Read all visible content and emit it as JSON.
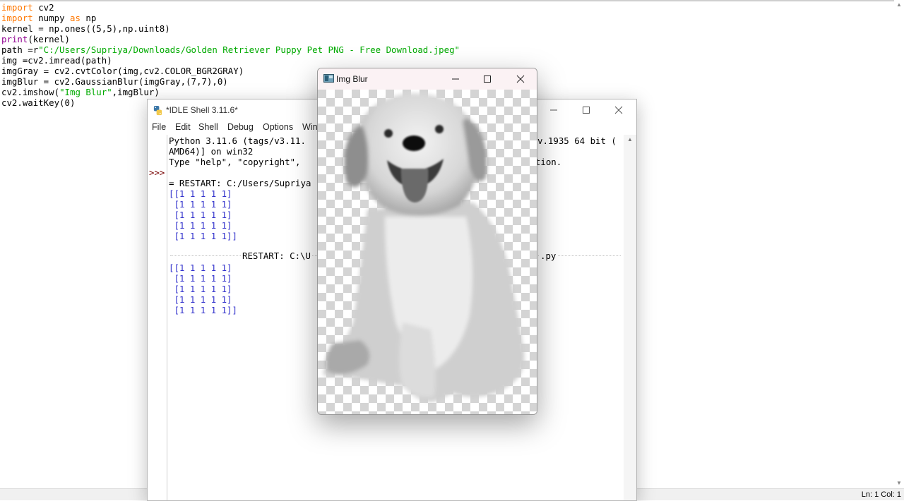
{
  "editor": {
    "code_lines": [
      [
        {
          "t": "import",
          "c": "kw"
        },
        {
          "t": " cv2"
        }
      ],
      [
        {
          "t": "import",
          "c": "kw"
        },
        {
          "t": " numpy "
        },
        {
          "t": "as",
          "c": "kw"
        },
        {
          "t": " np"
        }
      ],
      [
        {
          "t": "kernel = np.ones((5,5),np.uint8)"
        }
      ],
      [
        {
          "t": "print",
          "c": "bi"
        },
        {
          "t": "(kernel)"
        }
      ],
      [
        {
          "t": "path =r"
        },
        {
          "t": "\"C:/Users/Supriya/Downloads/Golden Retriever Puppy Pet PNG - Free Download.jpeg\"",
          "c": "str"
        }
      ],
      [
        {
          "t": "img =cv2.imread(path)"
        }
      ],
      [
        {
          "t": "imgGray = cv2.cvtColor(img,cv2.COLOR_BGR2GRAY)"
        }
      ],
      [
        {
          "t": "imgBlur = cv2.GaussianBlur(imgGray,(7,7),0)"
        }
      ],
      [
        {
          "t": "cv2.imshow("
        },
        {
          "t": "\"Img Blur\"",
          "c": "str"
        },
        {
          "t": ",imgBlur)"
        }
      ],
      [
        {
          "t": "cv2.waitKey(0)"
        }
      ]
    ],
    "status": "Ln: 1  Col: 1"
  },
  "shell": {
    "title": "*IDLE Shell 3.11.6*",
    "menus": [
      "File",
      "Edit",
      "Shell",
      "Debug",
      "Options",
      "Win"
    ],
    "prompt": ">>>",
    "lines": [
      {
        "t": "Python 3.11.6 (tags/v3.11.",
        "tail": "v.1935 64 bit ("
      },
      {
        "t": "AMD64)] on win32"
      },
      {
        "t": "Type \"help\", \"copyright\",",
        "tail": "mation."
      },
      {
        "t": ""
      },
      {
        "t": "= RESTART: C:/Users/Supriya"
      },
      {
        "t": "[[1 1 1 1 1]",
        "c": "out"
      },
      {
        "t": " [1 1 1 1 1]",
        "c": "out"
      },
      {
        "t": " [1 1 1 1 1]",
        "c": "out"
      },
      {
        "t": " [1 1 1 1 1]",
        "c": "out"
      },
      {
        "t": " [1 1 1 1 1]]",
        "c": "out"
      },
      {
        "t": ""
      },
      {
        "t": ""
      },
      {
        "t": "[[1 1 1 1 1]",
        "c": "out"
      },
      {
        "t": " [1 1 1 1 1]",
        "c": "out"
      },
      {
        "t": " [1 1 1 1 1]",
        "c": "out"
      },
      {
        "t": " [1 1 1 1 1]",
        "c": "out"
      },
      {
        "t": " [1 1 1 1 1]]",
        "c": "out"
      }
    ],
    "restart2": "RESTART: C:\\U",
    "restart2_tail": ".py"
  },
  "blur_window": {
    "title": "Img Blur",
    "image_subject": "grayscale blurred golden retriever puppy on transparency checkerboard"
  },
  "icons": {
    "minimize": "minimize-icon",
    "maximize": "maximize-icon",
    "close": "close-icon"
  }
}
